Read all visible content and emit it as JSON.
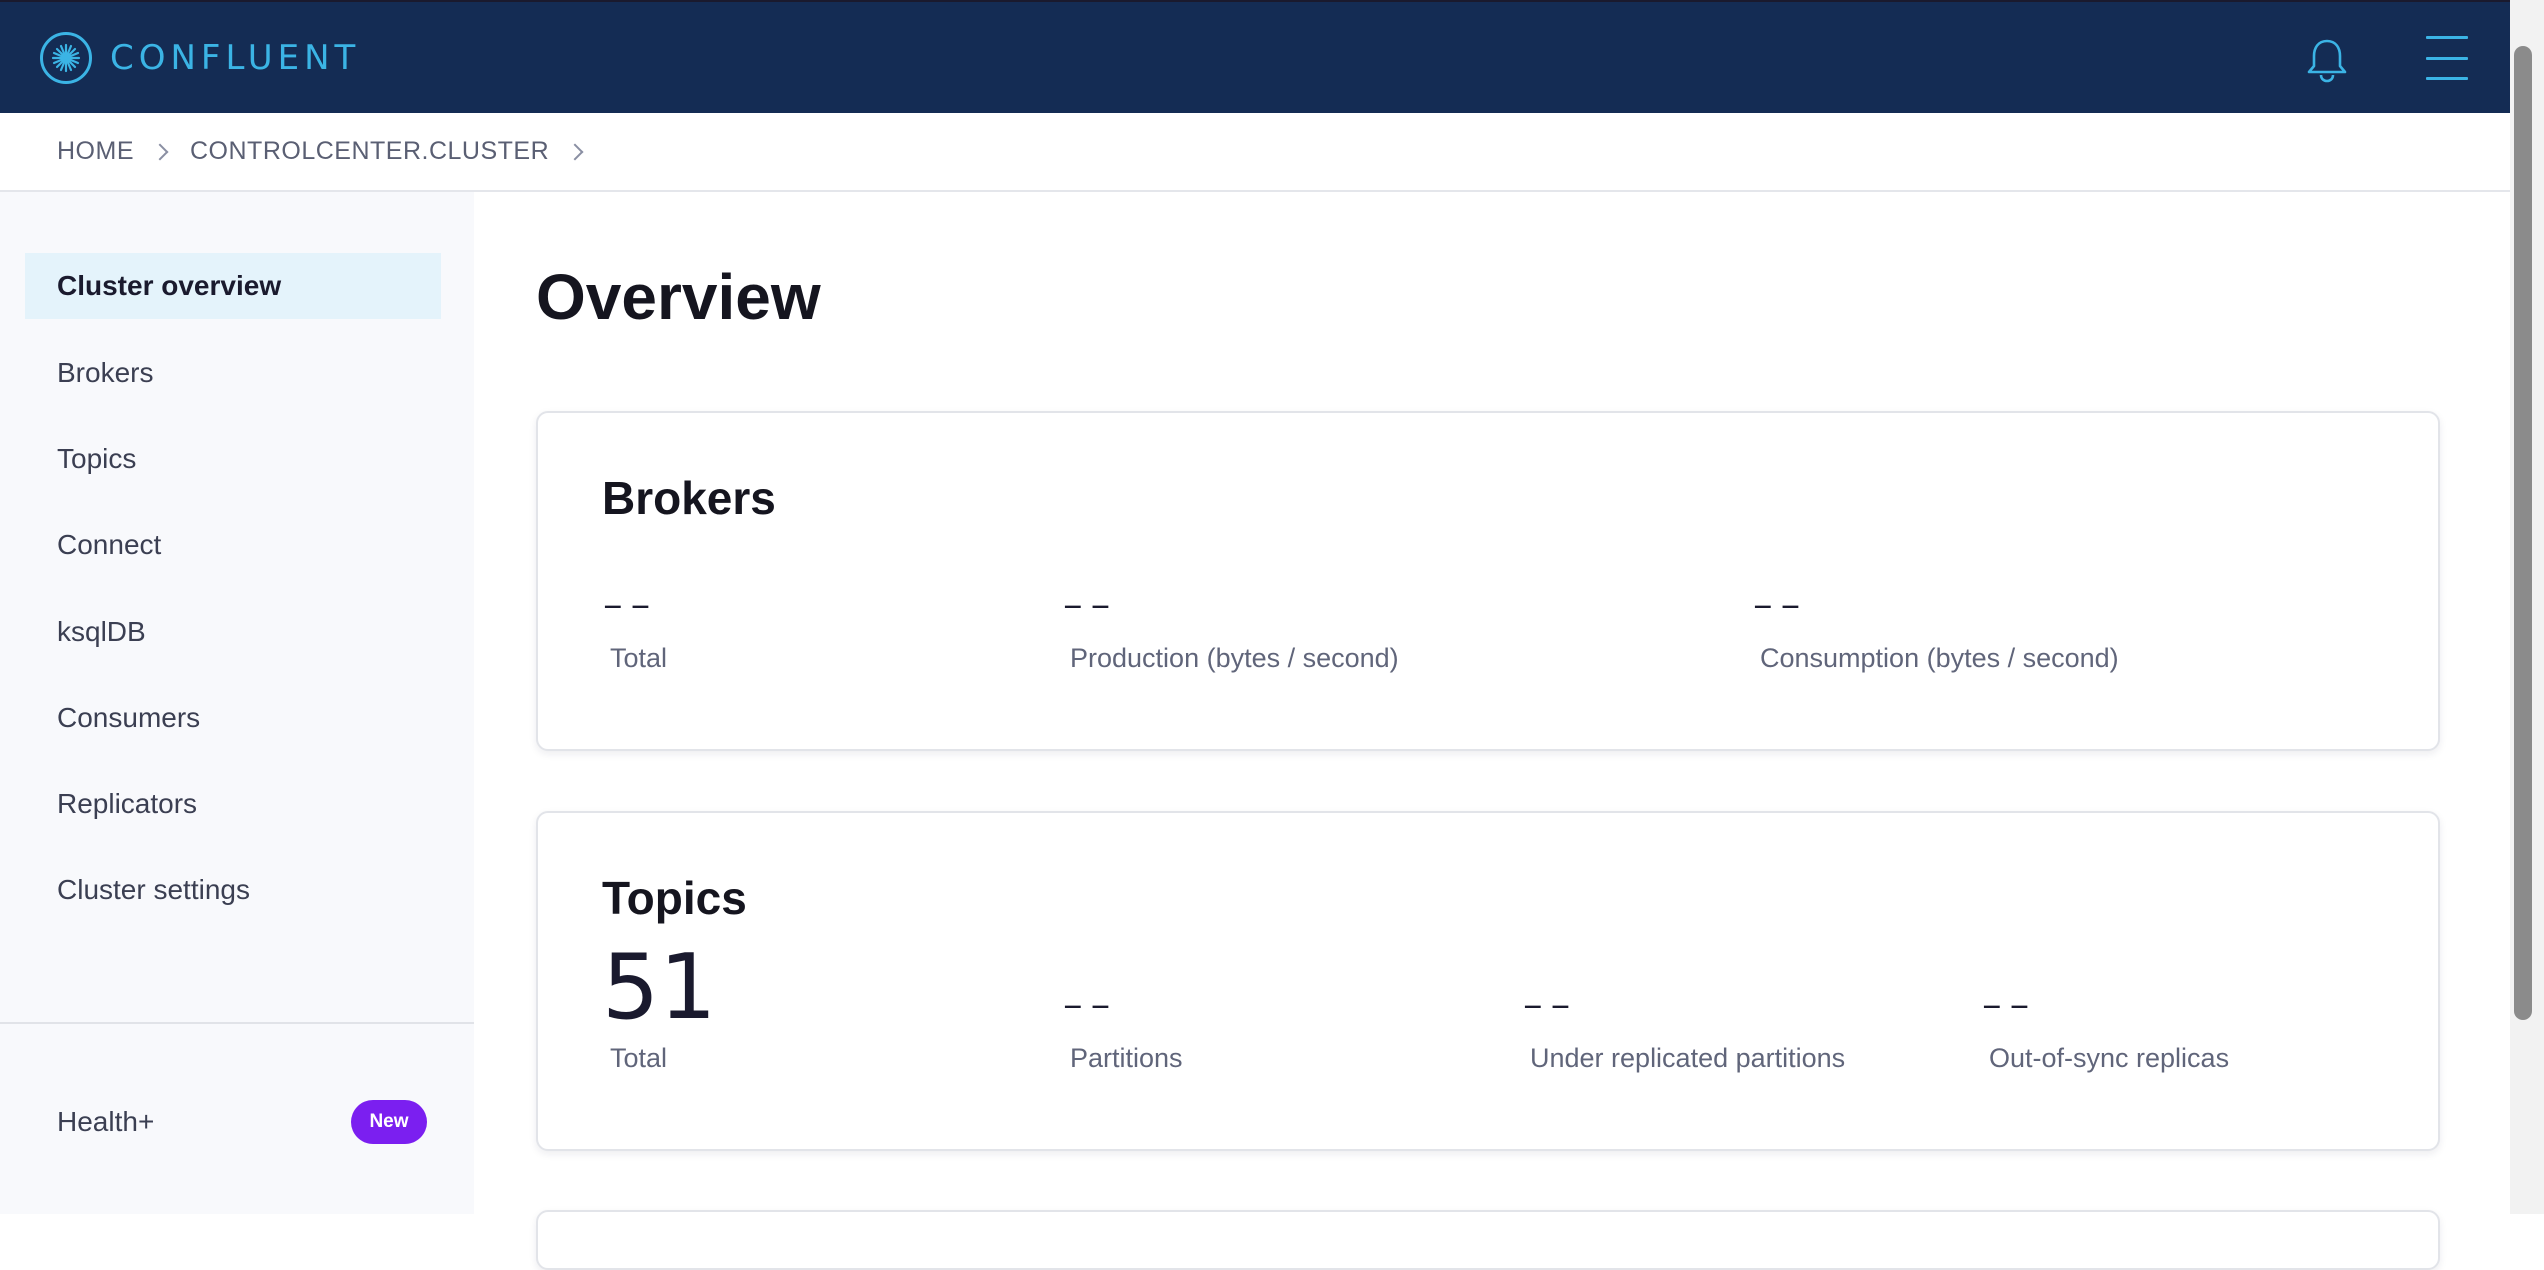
{
  "header": {
    "brand": "CONFLUENT",
    "logo_icon": "confluent-starburst-icon",
    "notifications_icon": "bell-icon",
    "menu_icon": "hamburger-menu-icon",
    "accent_color": "#3bb4e5",
    "background_color": "#142c54"
  },
  "breadcrumb": {
    "items": [
      "HOME",
      "CONTROLCENTER.CLUSTER"
    ]
  },
  "sidebar": {
    "items": [
      {
        "label": "Cluster overview",
        "active": true
      },
      {
        "label": "Brokers",
        "active": false
      },
      {
        "label": "Topics",
        "active": false
      },
      {
        "label": "Connect",
        "active": false
      },
      {
        "label": "ksqlDB",
        "active": false
      },
      {
        "label": "Consumers",
        "active": false
      },
      {
        "label": "Replicators",
        "active": false
      },
      {
        "label": "Cluster settings",
        "active": false
      }
    ],
    "health": {
      "label": "Health+",
      "badge": "New",
      "badge_color": "#7b1ff0"
    }
  },
  "main": {
    "title": "Overview",
    "brokers_card": {
      "title": "Brokers",
      "metrics": [
        {
          "value": "--",
          "label": "Total"
        },
        {
          "value": "--",
          "label": "Production (bytes / second)"
        },
        {
          "value": "--",
          "label": "Consumption (bytes / second)"
        }
      ]
    },
    "topics_card": {
      "title": "Topics",
      "metrics": [
        {
          "value": "51",
          "label": "Total"
        },
        {
          "value": "--",
          "label": "Partitions"
        },
        {
          "value": "--",
          "label": "Under replicated partitions"
        },
        {
          "value": "--",
          "label": "Out-of-sync replicas"
        }
      ]
    }
  }
}
